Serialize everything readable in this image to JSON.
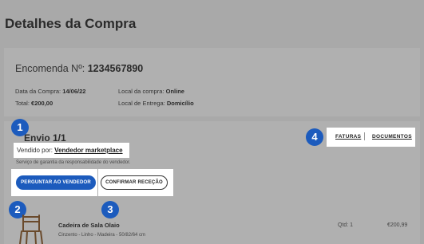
{
  "page": {
    "title": "Detalhes da Compra"
  },
  "order": {
    "number_label": "Encomenda Nº:",
    "number_value": "1234567890",
    "purchase_date_label": "Data da Compra:",
    "purchase_date_value": "14/06/22",
    "total_label": "Total:",
    "total_value": "€200,00",
    "purchase_place_label": "Local da compra:",
    "purchase_place_value": "Online",
    "delivery_place_label": "Local de Entrega:",
    "delivery_place_value": "Domicílio"
  },
  "shipment": {
    "title": "Envio 1/1",
    "sold_by_label": "Vendido por:",
    "sold_by_value": "Vendedor marketplace",
    "warranty": "Serviço de garantia da responsabilidade do vendedor.",
    "ask_seller_button": "PERGUNTAR AO VENDEDOR",
    "confirm_button": "CONFIRMAR RECEÇÃO",
    "invoices_link": "FATURAS",
    "documents_link": "DOCUMENTOS"
  },
  "product": {
    "name": "Cadeira de Sala Olaio",
    "description": "Cinzento - Linho - Madeira - 50/82/64 cm",
    "qty": "Qtd: 1",
    "price": "€200,99"
  },
  "markers": [
    "1",
    "2",
    "3",
    "4"
  ],
  "colors": {
    "accent": "#1c5bbd",
    "overlay": "#a9a9a9",
    "card": "#b0b0b0",
    "highlight": "#ffffff"
  }
}
